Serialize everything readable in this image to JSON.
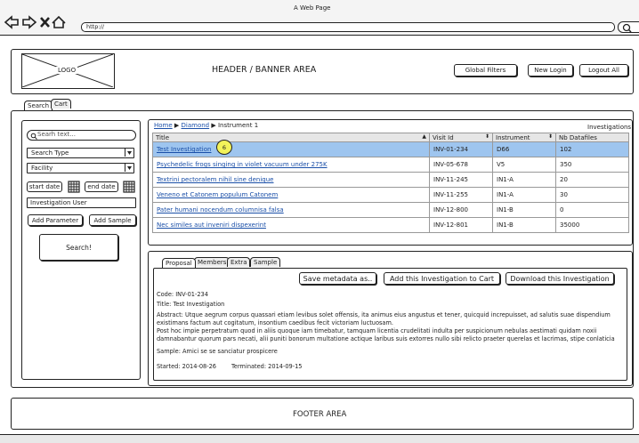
{
  "browser": {
    "window_title": "A Web Page",
    "address": "http://",
    "search_icon": "search-icon"
  },
  "header": {
    "logo": "LOGO",
    "banner": "HEADER / BANNER AREA",
    "buttons": [
      "Global Filters",
      "New Login",
      "Logout All"
    ]
  },
  "main_tabs": [
    "Search",
    "Cart"
  ],
  "search_panel": {
    "search_placeholder": "Searh text...",
    "search_type": "Search Type",
    "facility": "Facility",
    "start_date": "start date",
    "end_date": "end date",
    "investigation_user": "Investigation User",
    "add_parameter": "Add Parameter",
    "add_sample": "Add Sample",
    "search": "Search!"
  },
  "results": {
    "breadcrumb": [
      "Home",
      "Diamond",
      "Instrument 1"
    ],
    "panel_title": "Investigations",
    "columns": [
      "Title",
      "Visit Id",
      "Instrument",
      "Nb Datafiles"
    ],
    "rows": [
      {
        "title": "Test Investigation",
        "visit": "INV-01-234",
        "instrument": "D66",
        "files": "102"
      },
      {
        "title": "Psychedelic frogs singing in violet vacuum under 275K",
        "visit": "INV-05-678",
        "instrument": "V5",
        "files": "350"
      },
      {
        "title": "Textrini pectoralem nihil sine denique",
        "visit": "INV-11-245",
        "instrument": "IN1-A",
        "files": "20"
      },
      {
        "title": "Veneno et Catonem populum Catonem",
        "visit": "INV-11-255",
        "instrument": "IN1-A",
        "files": "30"
      },
      {
        "title": "Pater humani nocendum columnisa falsa",
        "visit": "INV-12-800",
        "instrument": "IN1-B",
        "files": "0"
      },
      {
        "title": "Nec similes aut inveniri dispexerint",
        "visit": "INV-12-801",
        "instrument": "IN1-B",
        "files": "35000"
      }
    ],
    "cursor_badge": "6"
  },
  "details": {
    "tabs": [
      "Proposal",
      "Members",
      "Extra",
      "Sample"
    ],
    "buttons": [
      "Save metadata as..",
      "Add this Investigation to Cart",
      "Download this Investigation"
    ],
    "code": "Code: INV-01-234",
    "title": "Title: Test Investigation",
    "abstract_lines": [
      "Abstract: Utque aegrum corpus quassari etiam levibus solet offensis, ita animus eius angustus et tener, quicquid increpuisset, ad salutis suae dispendium",
      "existimans factum aut cogitatum, insontium caedibus fecit victoriam luctuosam.",
      "Post hoc impie perpetratum quod in aliis quoque iam timebatur, tamquam licentia crudelitati indulta per suspicionum nebulas aestimati quidam noxii",
      "damnabantur quorum pars necati, alii puniti bonorum multatione actique laribus suis extorres nullo sibi relicto praeter querelas et lacrimas, stipe conlaticia"
    ],
    "sample": "Sample: Amici se se sanciatur prospicere",
    "started": "Started: 2014-08-26",
    "terminated": "Terminated: 2014-09-15"
  },
  "footer": "FOOTER AREA"
}
